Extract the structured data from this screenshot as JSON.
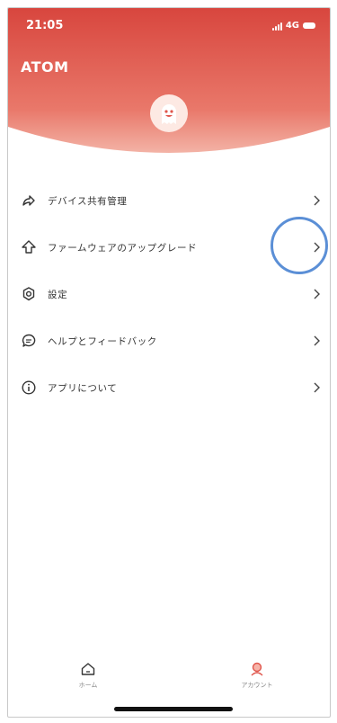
{
  "status_bar": {
    "time": "21:05",
    "network": "4G"
  },
  "header": {
    "brand": "ATOM"
  },
  "menu": {
    "items": [
      {
        "label": "デバイス共有管理",
        "icon": "share-icon"
      },
      {
        "label": "ファームウェアのアップグレード",
        "icon": "upgrade-arrow-icon"
      },
      {
        "label": "設定",
        "icon": "settings-gear-icon"
      },
      {
        "label": "ヘルプとフィードバック",
        "icon": "chat-bubble-icon"
      },
      {
        "label": "アプリについて",
        "icon": "info-icon"
      }
    ]
  },
  "tabbar": {
    "tabs": [
      {
        "label": "ホーム",
        "icon": "home-icon",
        "active": false
      },
      {
        "label": "アカウント",
        "icon": "account-icon",
        "active": true
      }
    ]
  },
  "colors": {
    "header_top": "#d94a42",
    "header_bottom": "#ef8f7d",
    "accent": "#e0564c",
    "annotation_circle": "#5b8fd6"
  }
}
